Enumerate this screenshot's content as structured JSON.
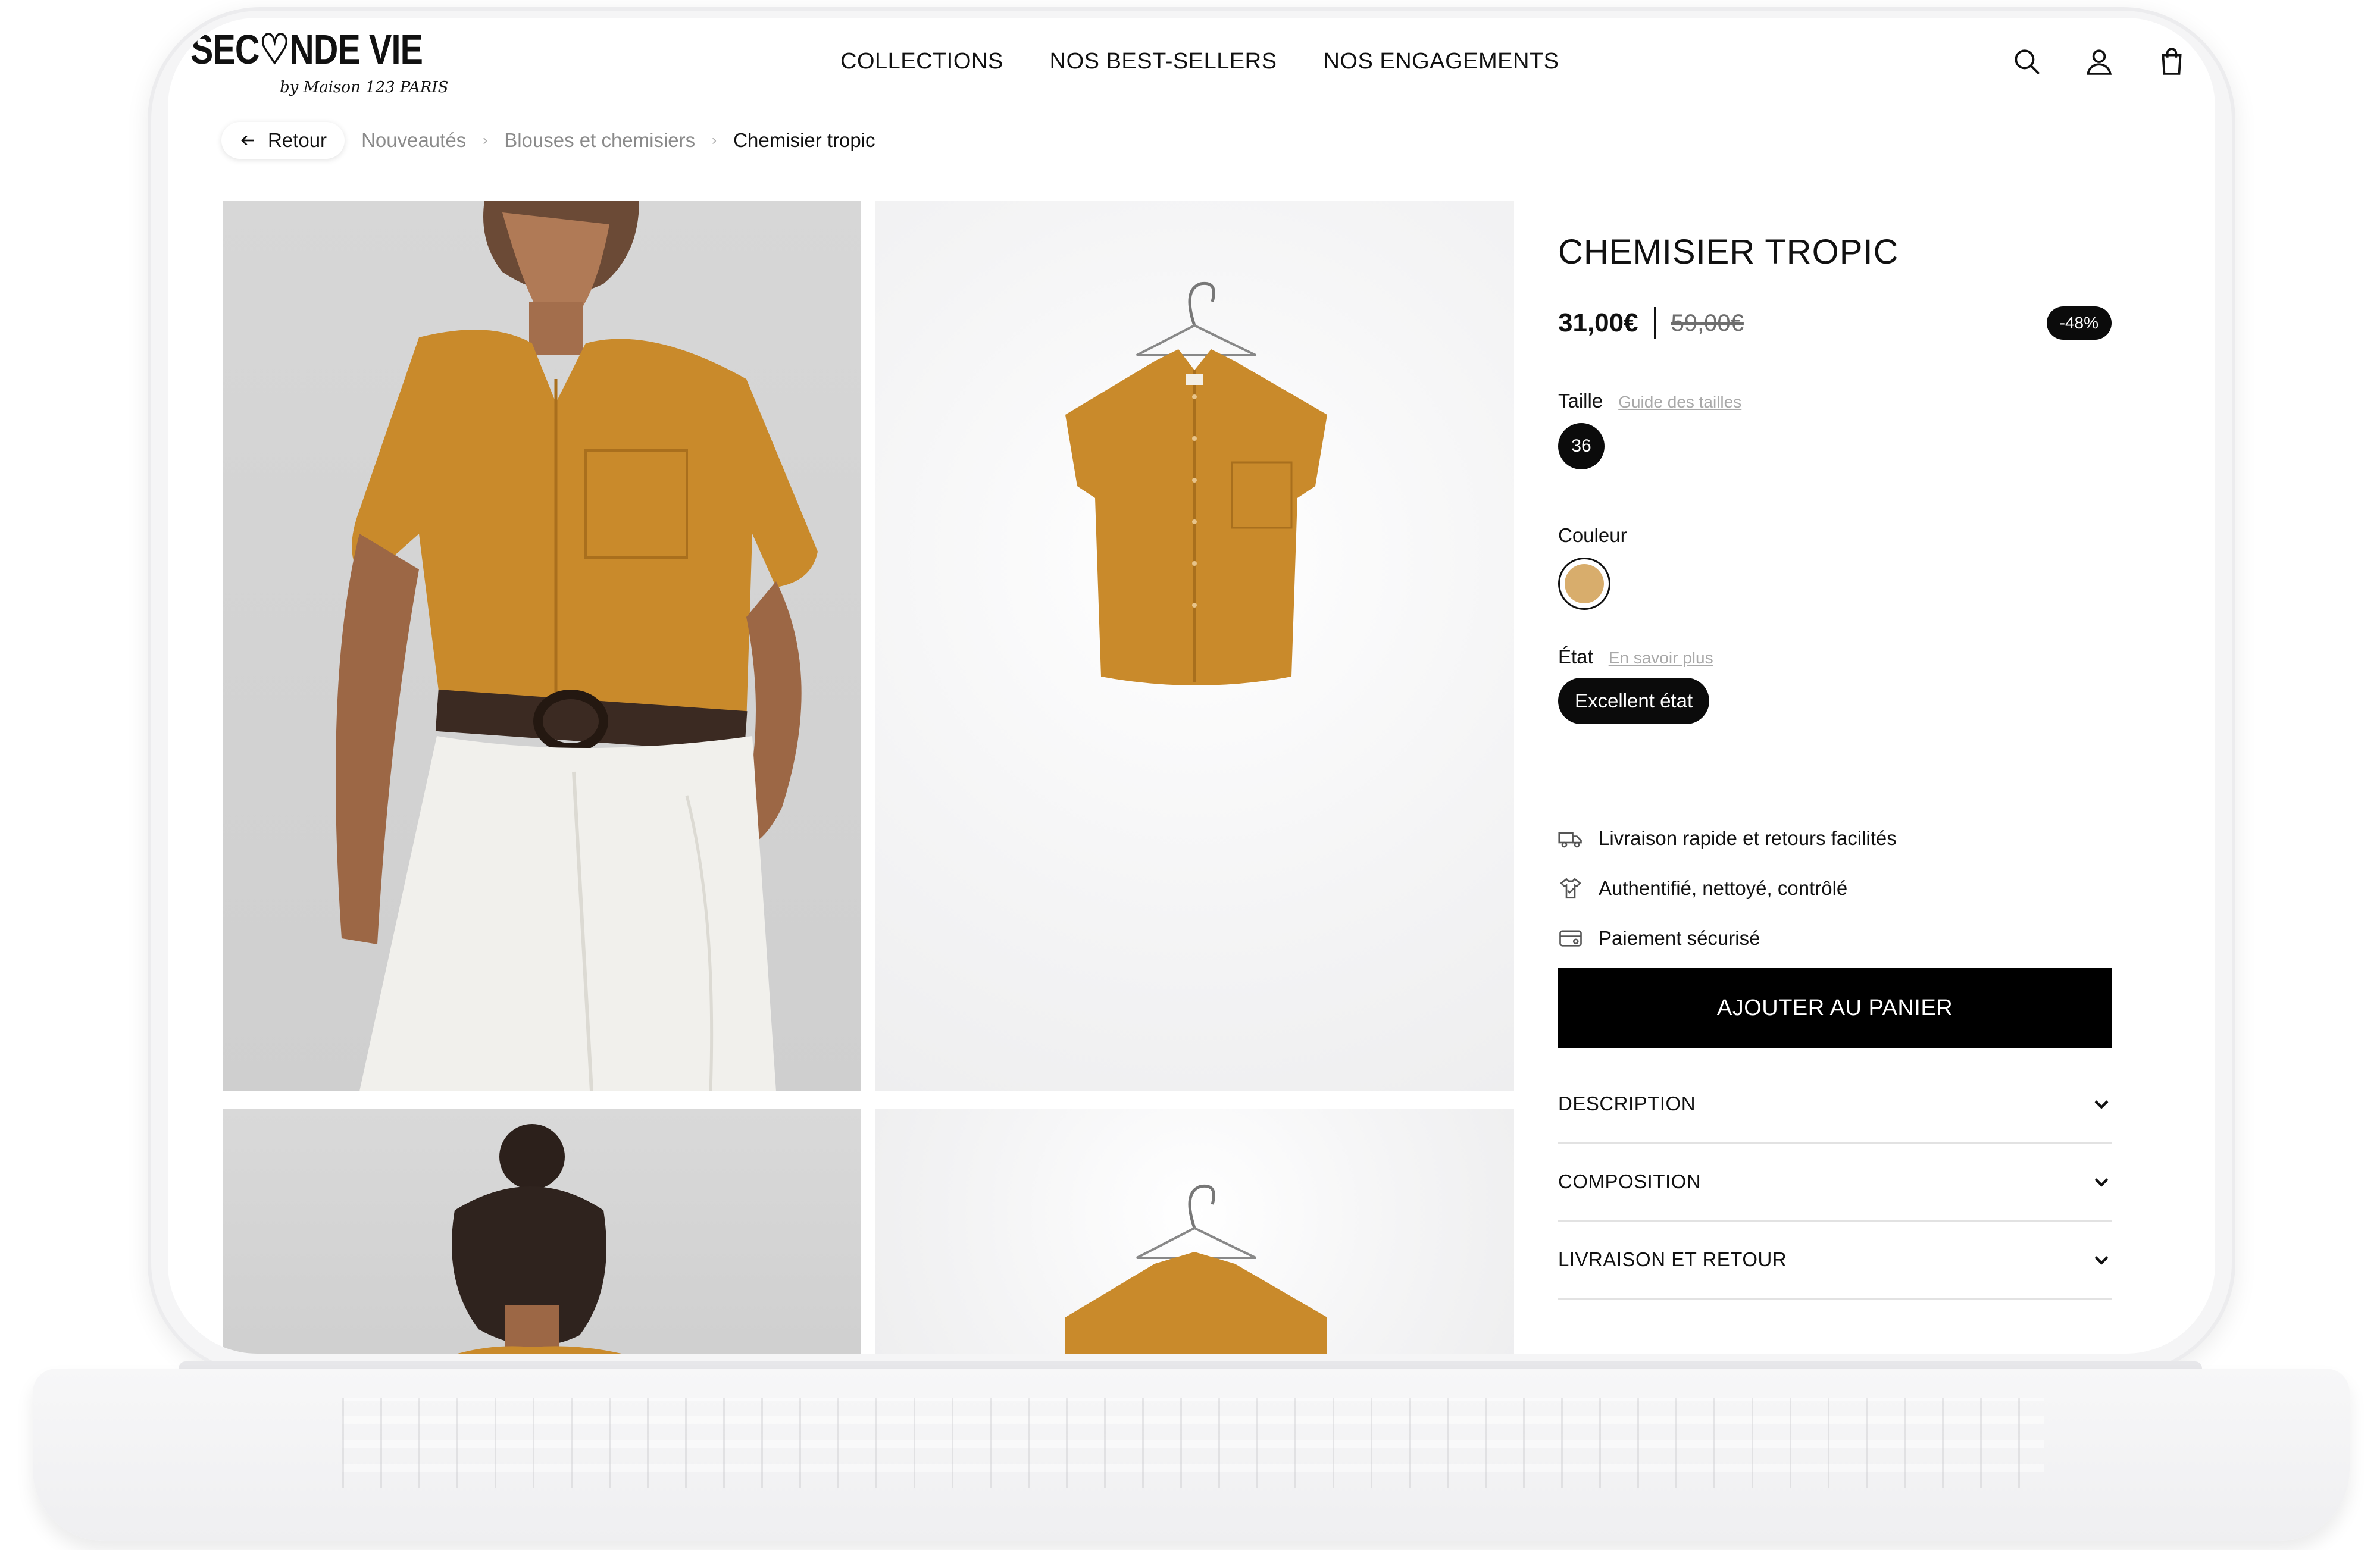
{
  "brand": {
    "name": "SEC♡NDE VIE",
    "sub": "by Maison 123 PARIS"
  },
  "nav": {
    "items": [
      "COLLECTIONS",
      "NOS BEST-SELLERS",
      "NOS ENGAGEMENTS"
    ]
  },
  "header_icons": [
    "search-icon",
    "account-icon",
    "bag-icon"
  ],
  "breadcrumb": {
    "back_label": "Retour",
    "items": [
      "Nouveautés",
      "Blouses et chemisiers",
      "Chemisier tropic"
    ]
  },
  "product": {
    "title": "CHEMISIER TROPIC",
    "price": "31,00€",
    "old_price": "59,00€",
    "discount": "-48%",
    "size_label": "Taille",
    "size_guide_link": "Guide des tailles",
    "size_value": "36",
    "color_label": "Couleur",
    "color_swatch": "#d8ad6c",
    "state_label": "État",
    "state_link": "En savoir plus",
    "state_value": "Excellent état",
    "features": [
      {
        "icon": "truck-icon",
        "label": "Livraison rapide et retours facilités"
      },
      {
        "icon": "shirt-check-icon",
        "label": "Authentifié, nettoyé, contrôlé"
      },
      {
        "icon": "card-icon",
        "label": "Paiement sécurisé"
      }
    ],
    "cta": "AJOUTER AU PANIER",
    "accordions": [
      "DESCRIPTION",
      "COMPOSITION",
      "LIVRAISON ET RETOUR"
    ]
  },
  "colors": {
    "accent": "#000000",
    "shirt": "#c98a2b"
  }
}
